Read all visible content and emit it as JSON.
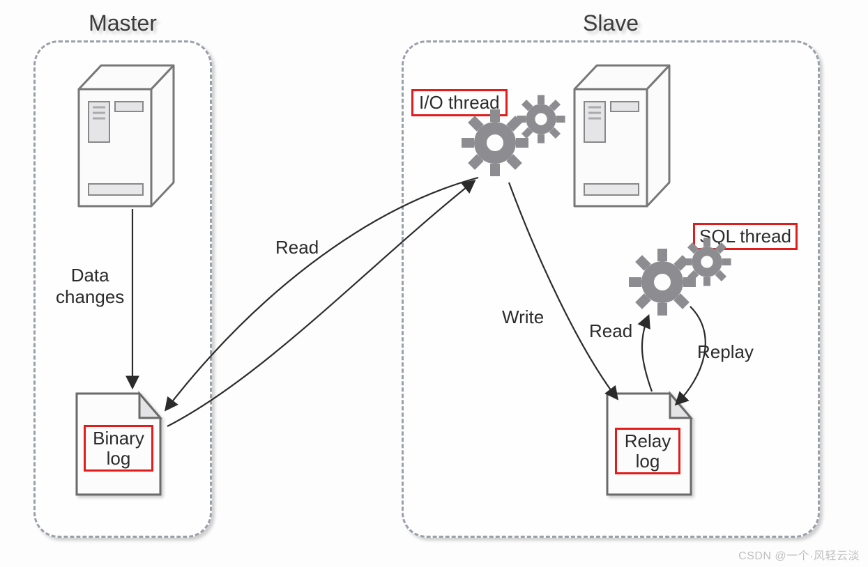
{
  "master": {
    "title": "Master"
  },
  "slave": {
    "title": "Slave"
  },
  "labels": {
    "data_changes": "Data\nchanges",
    "read_across": "Read",
    "write": "Write",
    "read_relay": "Read",
    "replay": "Replay"
  },
  "boxes": {
    "binary_log": "Binary\nlog",
    "io_thread": "I/O thread",
    "sql_thread": "SQL thread",
    "relay_log": "Relay\nlog"
  },
  "watermark": "CSDN @一个·风轻云淡"
}
